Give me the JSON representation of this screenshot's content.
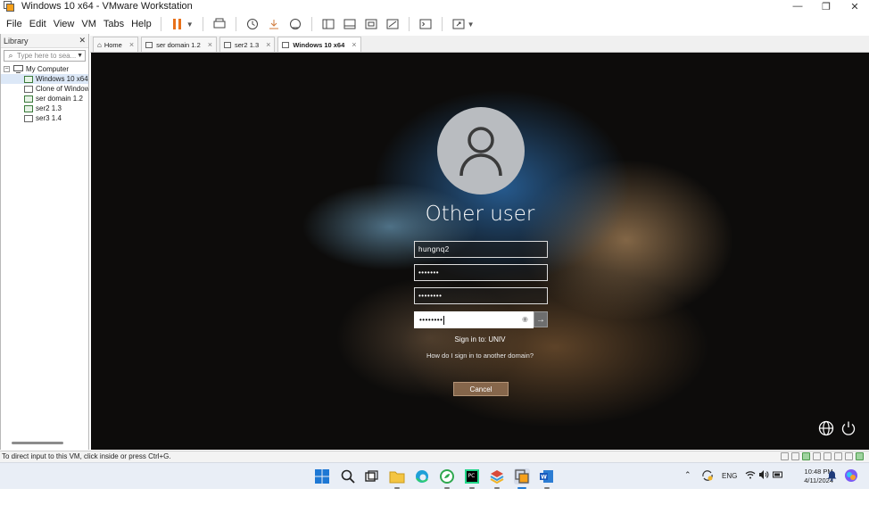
{
  "window": {
    "title": "Windows 10 x64 - VMware Workstation"
  },
  "menu": [
    "File",
    "Edit",
    "View",
    "VM",
    "Tabs",
    "Help"
  ],
  "library": {
    "title": "Library",
    "search_placeholder": "Type here to sea...",
    "root": "My Computer",
    "items": [
      "Windows 10 x64",
      "Clone of Window",
      "ser domain 1.2",
      "ser2 1.3",
      "ser3 1.4"
    ]
  },
  "tabs": [
    "Home",
    "ser domain 1.2",
    "ser2 1.3",
    "Windows 10 x64"
  ],
  "login": {
    "user": "Other user",
    "username_value": "hungnq2",
    "password1_mask": "•••••••",
    "password2_mask": "••••••••",
    "password3_mask": "••••••••",
    "sign_in_to": "Sign in to: UNIV",
    "other_domain_link": "How do I sign in to another domain?",
    "cancel_label": "Cancel"
  },
  "statusbar": {
    "hint": "To direct input to this VM, click inside or press Ctrl+G."
  },
  "taskbar": {
    "language": "ENG",
    "time": "10:48 PM",
    "date": "4/11/2024"
  },
  "icons": {
    "reveal": "eye-icon",
    "submit": "arrow-right-icon",
    "network": "globe-icon",
    "power": "power-icon"
  },
  "colors": {
    "accent": "#3a7bd5",
    "pause": "#e8711a"
  }
}
